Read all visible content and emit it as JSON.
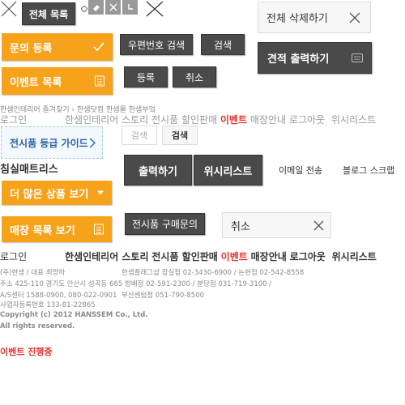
{
  "top": {
    "all_list": "전체 목록",
    "delete_all": "전체 삭제하기",
    "print_estimate": "견적 출력하기"
  },
  "orange": {
    "inquiry": "문의 등록",
    "event_list": "이벤트 목록",
    "more_products": "더 많은 상품 보기",
    "store_list": "매장 목록 보기"
  },
  "buttons": {
    "zip_search": "우편번호 검색",
    "search": "검색",
    "register": "등록",
    "cancel": "취소",
    "print": "출력하기",
    "wishlist": "위시리스트",
    "email_send": "이메일 전송",
    "blog_scrap": "블로그 스크랩",
    "showroom_inquiry": "전시품 구매문의",
    "search_light1": "검색",
    "search_light2": "검색",
    "cancel_light": "취소"
  },
  "links_small": {
    "bookmark": "한샘인테리어 즐겨찾기",
    "sep": "›",
    "dot": "한샘닷컴",
    "mall": "한샘몰",
    "hansem_bu": "한샘부엌"
  },
  "nav": {
    "login": "로그인",
    "story": "한샘인테리어 스토리",
    "sale": "전시품 할인판매",
    "event": "이벤트",
    "store": "매장안내",
    "logout": "로그아웃",
    "wishlist": "위시리스트"
  },
  "guide": {
    "label": "전시품 등급 가이드"
  },
  "mattress": "침실매트리스",
  "footer": {
    "line1a": "(주)한샘 / 대표 최양하",
    "line1b": "한샘플래그샵 잠실점 02-3430-6900 / 논현점 02-542-8558",
    "line2": "주소 425-110 경기도 안산시 성곡동 665 방배점 02-591-2300 / 분당점 031-719-3100 /",
    "line3a": "A/S센터 1588-0900, 080-022-0901",
    "line3b": "부산센텀점 051-790-8500",
    "line4": "사업자등록번호 133-81-22865",
    "line5": "Copyright (c) 2012 HANSSEM Co., Ltd.",
    "line6": "All rights reserved."
  },
  "event_ongoing": "이벤트 진행중",
  "colors": {
    "orange": "#f7a21b",
    "dark": "#4a4a4a",
    "event_red": "#e5322d"
  }
}
